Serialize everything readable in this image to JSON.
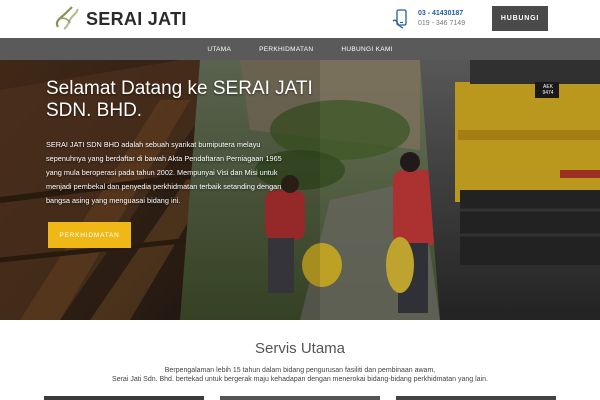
{
  "header": {
    "logo_text": "SERAI JATI",
    "phone_primary": "03 - 41430187",
    "phone_secondary": "019 - 346 7149",
    "contact_button": "HUBUNGI"
  },
  "nav": {
    "items": [
      {
        "label": "UTAMA"
      },
      {
        "label": "PERKHIDMATAN"
      },
      {
        "label": "HUBUNGI KAMI"
      }
    ]
  },
  "hero": {
    "title": "Selamat Datang ke SERAI JATI SDN. BHD.",
    "body": "SERAI JATI SDN BHD adalah sebuah syarikat bumiputera melayu sepenuhnya yang berdaftar di bawah Akta Pendaftaran Perniagaan 1965 yang mula beroperasi pada tahun 2002. Mempunyai Visi dan Misi untuk menjadi pembekal dan penyedia perkhidmatan terbaik setanding dengan bangsa asing yang menguasai bidang ini.",
    "button": "PERKHIDMATAN",
    "plate_text": "AEK 9474"
  },
  "services": {
    "title": "Servis Utama",
    "description_line1": "Berpengalaman lebih 15 tahun dalam bidang pengurusan fasiliti dan pembinaan awam,",
    "description_line2": "Serai Jati Sdn. Bhd. bertekad untuk bergerak maju kehadapan dengan menerokai bidang-bidang perkhidmatan yang lain."
  },
  "colors": {
    "nav_bg": "#5a5a5a",
    "button_dark": "#4a4a4a",
    "accent_yellow": "#f0b816",
    "phone_blue": "#1f5ea8"
  },
  "icons": {
    "logo": "serai-jati-logo-icon",
    "phone": "phone-hand-icon"
  }
}
